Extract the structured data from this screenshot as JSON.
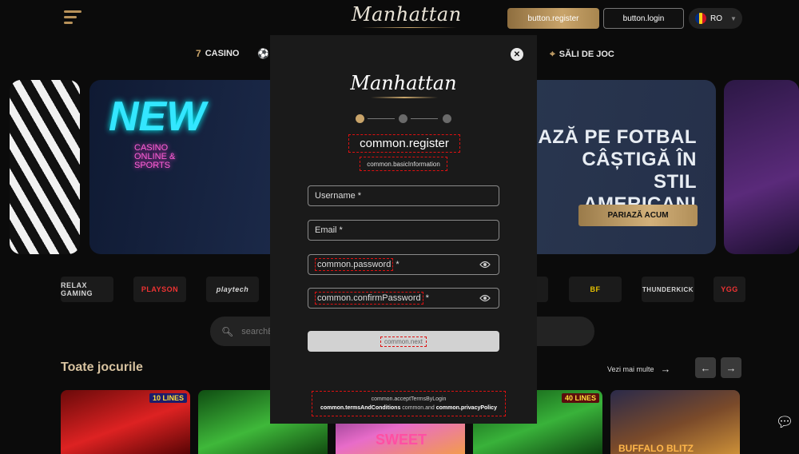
{
  "header": {
    "logo": "Manhattan",
    "register_label": "button.register",
    "login_label": "button.login",
    "language": "RO",
    "flag_colors": [
      "#002b7f",
      "#fcd116",
      "#ce1126"
    ]
  },
  "nav": {
    "items": [
      {
        "label": "CASINO",
        "icon": "seven-icon"
      },
      {
        "label": "",
        "icon": "ball-icon"
      },
      {
        "label": "SĂLI DE JOC",
        "icon": "location-pin-icon"
      }
    ]
  },
  "banner": {
    "neon_title": "NEW",
    "neon_subtitle": "CASINO ONLINE & SPORTS",
    "headline": "AZĂ PE FOTBAL CÂȘTIGĂ ÎN STIL AMERICAN!",
    "cta_label": "PARIAZĂ ACUM"
  },
  "providers": [
    "RELAX GAMING",
    "PLAYSON",
    "playtech",
    "",
    "",
    "THUNDERKICK",
    "YGG"
  ],
  "search": {
    "placeholder": "searchB"
  },
  "games": {
    "title": "Toate jocurile",
    "see_more": "Vezi mai multe",
    "badges": [
      "10 LINES",
      "40 LINES"
    ],
    "card_titles": [
      "SWEET",
      "BUFFALO BLITZ"
    ]
  },
  "modal": {
    "logo": "Manhattan",
    "title": "common.register",
    "subtitle": "common.basicInformation",
    "steps_total": 3,
    "step_active": 1,
    "fields": {
      "username": "Username *",
      "email": "Email *",
      "password": "common.password",
      "confirm_password": "common.confirmPassword",
      "required_mark": "*"
    },
    "submit_label": "common.next",
    "terms": {
      "line1": "common.acceptTermsByLogin",
      "terms_link": "common.termsAndConditions",
      "and": "common.and",
      "privacy_link": "common.privacyPolicy"
    }
  },
  "colors": {
    "accent_gold": "#c9a46a",
    "background": "#0b0b0b",
    "modal_bg": "#1a1a1a"
  }
}
